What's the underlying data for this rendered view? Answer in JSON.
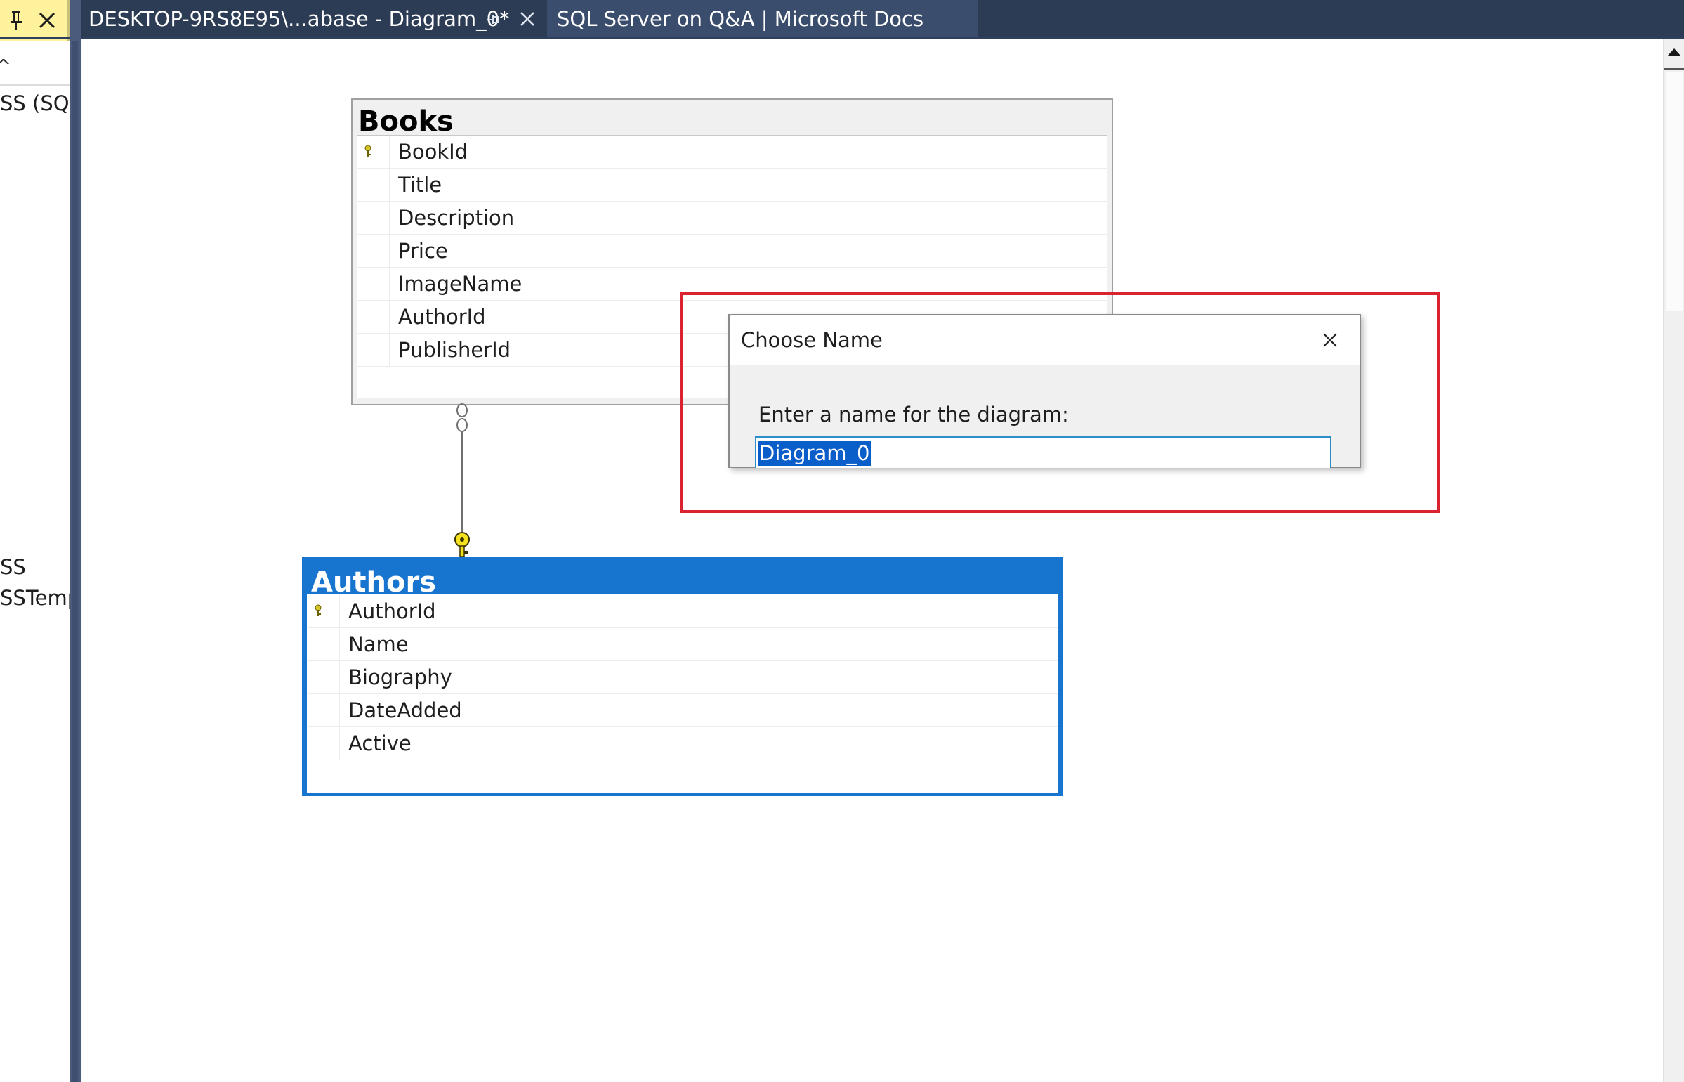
{
  "tabs": {
    "active": {
      "label": "DESKTOP-9RS8E95\\...abase - Diagram_0*"
    },
    "second": {
      "label": "SQL Server on Q&A | Microsoft Docs"
    }
  },
  "explorer": {
    "items": [
      {
        "label": "SS (SQL"
      },
      {
        "label": "SS"
      },
      {
        "label": "SSTemp"
      }
    ]
  },
  "books_table": {
    "title": "Books",
    "columns": [
      "BookId",
      "Title",
      "Description",
      "Price",
      "ImageName",
      "AuthorId",
      "PublisherId"
    ]
  },
  "authors_table": {
    "title": "Authors",
    "columns": [
      "AuthorId",
      "Name",
      "Biography",
      "DateAdded",
      "Active"
    ]
  },
  "dialog": {
    "title": "Choose Name",
    "label": "Enter a name for the diagram:",
    "input_value": "Diagram_0"
  },
  "colors": {
    "tabbar": "#2d3c55",
    "selection_blue": "#1775cf",
    "highlight_red": "#d9232e",
    "pinned_yellow": "#fff29d"
  },
  "icons": [
    "pin-icon",
    "close-icon",
    "primary-key-icon",
    "relationship-key-icon",
    "scroll-up-arrow-icon"
  ]
}
